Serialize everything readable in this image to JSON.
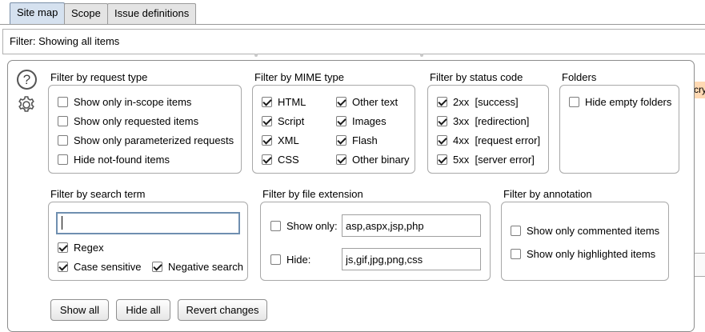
{
  "tabs": [
    {
      "label": "Site map",
      "active": true
    },
    {
      "label": "Scope",
      "active": false
    },
    {
      "label": "Issue definitions",
      "active": false
    }
  ],
  "filter_bar": {
    "text": "Filter: Showing all items"
  },
  "request_type": {
    "title": "Filter by request type",
    "items": [
      {
        "label": "Show only in-scope items",
        "checked": false
      },
      {
        "label": "Show only requested items",
        "checked": false
      },
      {
        "label": "Show only parameterized requests",
        "checked": false
      },
      {
        "label": "Hide not-found items",
        "checked": false
      }
    ]
  },
  "mime_type": {
    "title": "Filter by MIME type",
    "items": [
      {
        "label": "HTML",
        "checked": true
      },
      {
        "label": "Script",
        "checked": true
      },
      {
        "label": "XML",
        "checked": true
      },
      {
        "label": "CSS",
        "checked": true
      },
      {
        "label": "Other text",
        "checked": true
      },
      {
        "label": "Images",
        "checked": true
      },
      {
        "label": "Flash",
        "checked": true
      },
      {
        "label": "Other binary",
        "checked": true
      }
    ]
  },
  "status_code": {
    "title": "Filter by status code",
    "items": [
      {
        "label": "2xx  [success]",
        "checked": true
      },
      {
        "label": "3xx  [redirection]",
        "checked": true
      },
      {
        "label": "4xx  [request error]",
        "checked": true
      },
      {
        "label": "5xx  [server error]",
        "checked": true
      }
    ]
  },
  "folders": {
    "title": "Folders",
    "items": [
      {
        "label": "Hide empty folders",
        "checked": false
      }
    ]
  },
  "search_term": {
    "title": "Filter by search term",
    "value": "",
    "options": [
      {
        "label": "Regex",
        "checked": true
      },
      {
        "label": "Case sensitive",
        "checked": true
      },
      {
        "label": "Negative search",
        "checked": true
      }
    ]
  },
  "file_extension": {
    "title": "Filter by file extension",
    "show_only": {
      "label": "Show only:",
      "checked": false,
      "value": "asp,aspx,jsp,php"
    },
    "hide": {
      "label": "Hide:",
      "checked": false,
      "value": "js,gif,jpg,png,css"
    }
  },
  "annotation": {
    "title": "Filter by annotation",
    "items": [
      {
        "label": "Show only commented items",
        "checked": false
      },
      {
        "label": "Show only highlighted items",
        "checked": false
      }
    ]
  },
  "buttons": {
    "show_all": "Show all",
    "hide_all": "Hide all",
    "revert": "Revert changes"
  },
  "background_fragment": "cry",
  "icons": {
    "help": "question-circle",
    "settings": "gear"
  },
  "colors": {
    "active_tab": "#d5e1ef",
    "search_focus": "#6f8fb0",
    "fragment_bg": "#ffd9b3"
  }
}
